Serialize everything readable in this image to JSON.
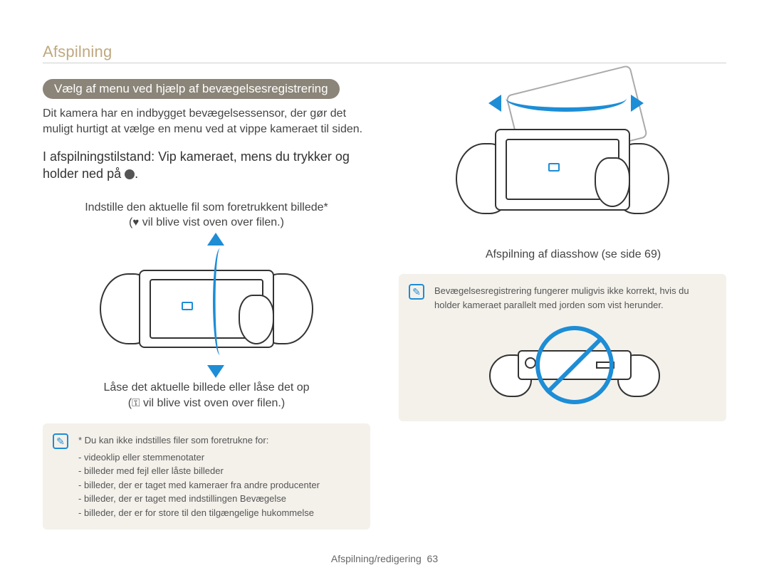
{
  "header": {
    "title": "Afspilning"
  },
  "left": {
    "pill": "Vælg af menu ved hjælp af bevægelsesregistrering",
    "intro": "Dit kamera har en indbygget bevægelsessensor, der gør det muligt hurtigt at vælge en menu ved at vippe kameraet til siden.",
    "instruction": "I afspilningstilstand: Vip kameraet, mens du trykker og holder ned på ",
    "instruction_suffix": ".",
    "fig1_caption_line1": "Indstille den aktuelle fil som foretrukkent billede*",
    "fig1_caption_line2_pre": "(",
    "fig1_caption_line2_post": " vil blive vist oven over filen.)",
    "fig2_caption_line1": "Låse det aktuelle billede eller låse det op",
    "fig2_caption_line2_pre": "(",
    "fig2_caption_line2_post": " vil blive vist oven over filen.)",
    "note_lead": "* Du kan ikke indstilles filer som foretrukne for:",
    "note_items": [
      "videoklip eller stemmenotater",
      "billeder med fejl eller låste billeder",
      "billeder, der er taget med kameraer fra andre producenter",
      "billeder, der er taget med indstillingen Bevægelse",
      "billeder, der er for store til den tilgængelige hukommelse"
    ]
  },
  "right": {
    "caption": "Afspilning af diasshow (se side 69)",
    "note": "Bevægelsesregistrering fungerer muligvis ikke korrekt, hvis du holder kameraet parallelt med jorden som vist herunder."
  },
  "footer": {
    "section": "Afspilning/redigering",
    "page": "63"
  },
  "icons": {
    "heart": "♥",
    "key": "⚿",
    "note": "✎"
  }
}
